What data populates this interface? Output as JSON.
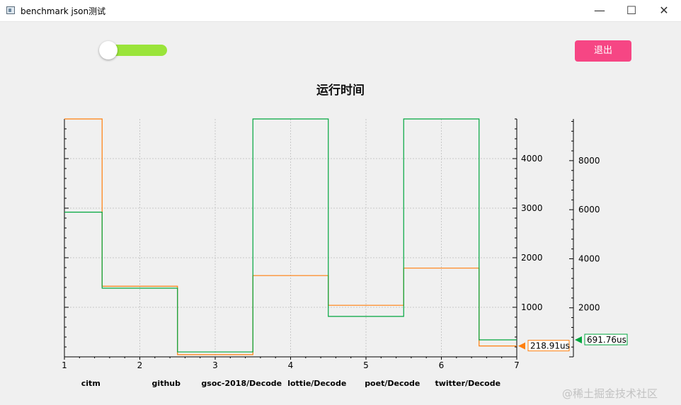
{
  "window": {
    "title": "benchmark json测试",
    "min_glyph": "—",
    "max_glyph": "☐",
    "close_glyph": "✕"
  },
  "toolbar": {
    "toggle_on": true,
    "toggle_color": "#9ae43a",
    "exit_label": "退出",
    "exit_color": "#f64684"
  },
  "watermark": "@稀土掘金技术社区",
  "chart_data": {
    "type": "line",
    "title": "运行时间",
    "categories": [
      "citm",
      "github",
      "gsoc-2018/Decode",
      "lottie/Decode",
      "poet/Decode",
      "twitter/Decode"
    ],
    "x_ticks": [
      1,
      2,
      3,
      4,
      5,
      6,
      7
    ],
    "xlim": [
      1,
      7
    ],
    "step": true,
    "grid": true,
    "axes": [
      {
        "name": "y1",
        "ticks": [
          1000,
          2000,
          3000,
          4000
        ],
        "ylim": [
          0,
          4800
        ]
      },
      {
        "name": "y2",
        "ticks": [
          2000,
          4000,
          6000,
          8000
        ],
        "ylim": [
          0,
          9700
        ]
      }
    ],
    "series": [
      {
        "axis": "y1",
        "color": "#ff7f0e",
        "values": [
          4800,
          1425,
          45,
          1640,
          1040,
          1790,
          220
        ],
        "end_label": "218.91us"
      },
      {
        "axis": "y2",
        "color": "#00a63e",
        "values": [
          5900,
          2800,
          200,
          9700,
          1650,
          9700,
          692
        ],
        "end_label": "691.76us"
      }
    ]
  }
}
